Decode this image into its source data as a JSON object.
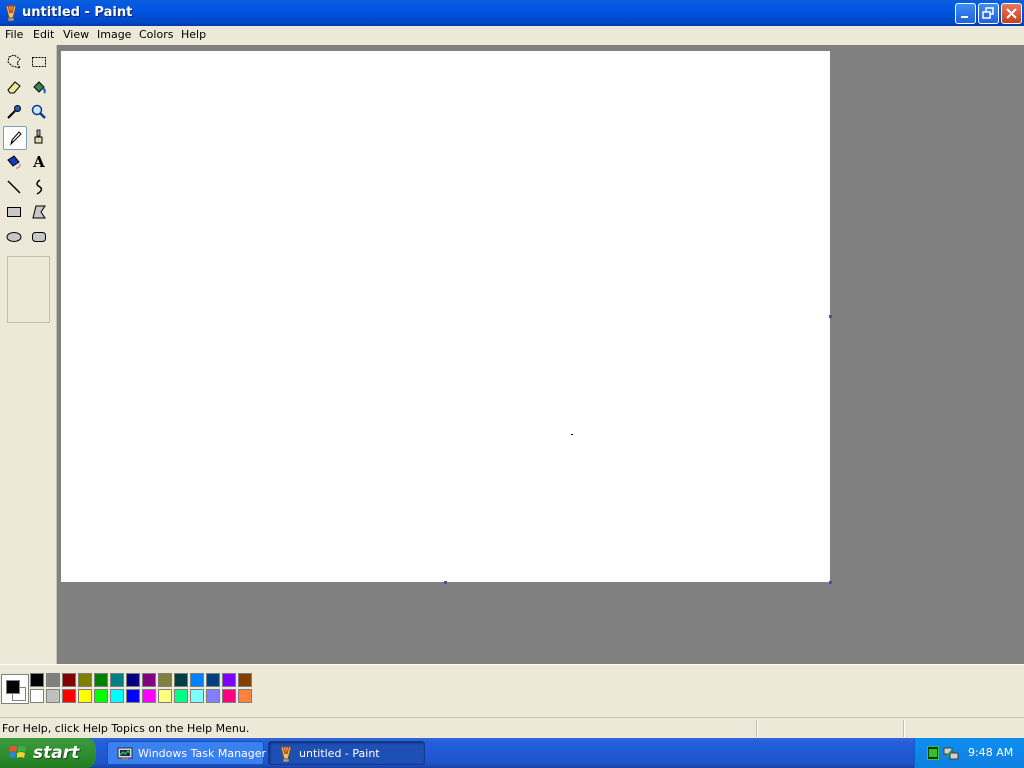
{
  "window": {
    "title": "untitled - Paint",
    "controls": [
      "minimize",
      "restore",
      "close"
    ]
  },
  "menu": [
    "File",
    "Edit",
    "View",
    "Image",
    "Colors",
    "Help"
  ],
  "tools": [
    {
      "name": "free-form-select",
      "icon": "free-select-icon"
    },
    {
      "name": "select",
      "icon": "rect-select-icon"
    },
    {
      "name": "eraser",
      "icon": "eraser-icon"
    },
    {
      "name": "fill-with-color",
      "icon": "fill-bucket-icon"
    },
    {
      "name": "pick-color",
      "icon": "eyedropper-icon"
    },
    {
      "name": "magnifier",
      "icon": "magnifier-icon"
    },
    {
      "name": "pencil",
      "icon": "pencil-icon",
      "selected": true
    },
    {
      "name": "brush",
      "icon": "brush-icon"
    },
    {
      "name": "airbrush",
      "icon": "airbrush-icon"
    },
    {
      "name": "text",
      "icon": "text-icon",
      "glyph": "A"
    },
    {
      "name": "line",
      "icon": "line-icon"
    },
    {
      "name": "curve",
      "icon": "curve-icon"
    },
    {
      "name": "rectangle",
      "icon": "rectangle-icon"
    },
    {
      "name": "polygon",
      "icon": "polygon-icon"
    },
    {
      "name": "ellipse",
      "icon": "ellipse-icon"
    },
    {
      "name": "rounded-rectangle",
      "icon": "rounded-rect-icon"
    }
  ],
  "colors": {
    "foreground": "#000000",
    "background": "#ffffff",
    "palette_top": [
      "#000000",
      "#808080",
      "#800000",
      "#808000",
      "#008000",
      "#008080",
      "#000080",
      "#800080",
      "#808040",
      "#004040",
      "#0080ff",
      "#004080",
      "#8000ff",
      "#804000"
    ],
    "palette_bottom": [
      "#ffffff",
      "#c0c0c0",
      "#ff0000",
      "#ffff00",
      "#00ff00",
      "#00ffff",
      "#0000ff",
      "#ff00ff",
      "#ffff80",
      "#00ff80",
      "#80ffff",
      "#8080ff",
      "#ff0080",
      "#ff8040"
    ]
  },
  "status": {
    "help_text": "For Help, click Help Topics on the Help Menu."
  },
  "taskbar": {
    "start_label": "start",
    "tasks": [
      {
        "label": "Windows Task Manager",
        "icon": "task-manager-icon",
        "active": false
      },
      {
        "label": "untitled - Paint",
        "icon": "paint-icon",
        "active": true
      }
    ],
    "tray_icons": [
      "cpu-usage-icon",
      "network-icon"
    ],
    "clock": "9:48 AM"
  }
}
